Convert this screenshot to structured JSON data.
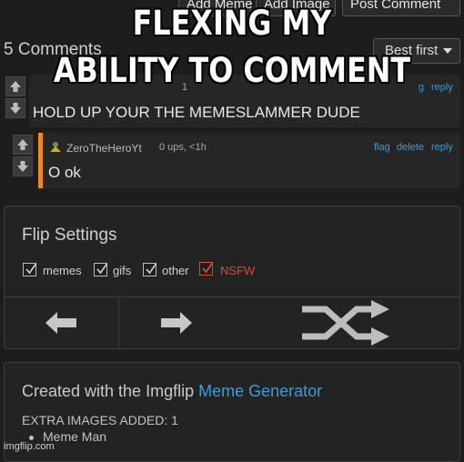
{
  "toolbar": {
    "add_meme": "Add Meme",
    "add_image": "Add Image",
    "post_comment": "Post Comment"
  },
  "comments": {
    "count_label": "5 Comments",
    "sort_label": "Best first",
    "first": {
      "meta_partial": "1",
      "text": "HOLD UP YOUR THE MEMESLAMMER DUDE",
      "flag_partial": "g",
      "reply": "reply"
    },
    "reply_comment": {
      "username": "ZeroTheHeroYt",
      "meta": "0 ups, <1h",
      "flag": "flag",
      "delete": "delete",
      "reply": "reply",
      "text": "O ok"
    }
  },
  "flip_settings": {
    "title": "Flip Settings",
    "options": [
      {
        "label": "memes",
        "checked": true,
        "color": "#d0d0d0"
      },
      {
        "label": "gifs",
        "checked": true,
        "color": "#d0d0d0"
      },
      {
        "label": "other",
        "checked": true,
        "color": "#d0d0d0"
      },
      {
        "label": "NSFW",
        "checked": true,
        "color": "#e0443c"
      }
    ]
  },
  "credits": {
    "created_prefix": "Created with the Imgflip ",
    "generator_link": "Meme Generator",
    "extra_images": "EXTRA IMAGES ADDED: 1",
    "list_item": "Meme Man"
  },
  "caption": {
    "line1": "FLEXING MY",
    "line2": "ABILITY TO COMMENT"
  },
  "watermark": "imgflip.com",
  "colors": {
    "link": "#3b9bd9",
    "accent_orange": "#f08a1c",
    "nsfw_red": "#e0443c"
  }
}
